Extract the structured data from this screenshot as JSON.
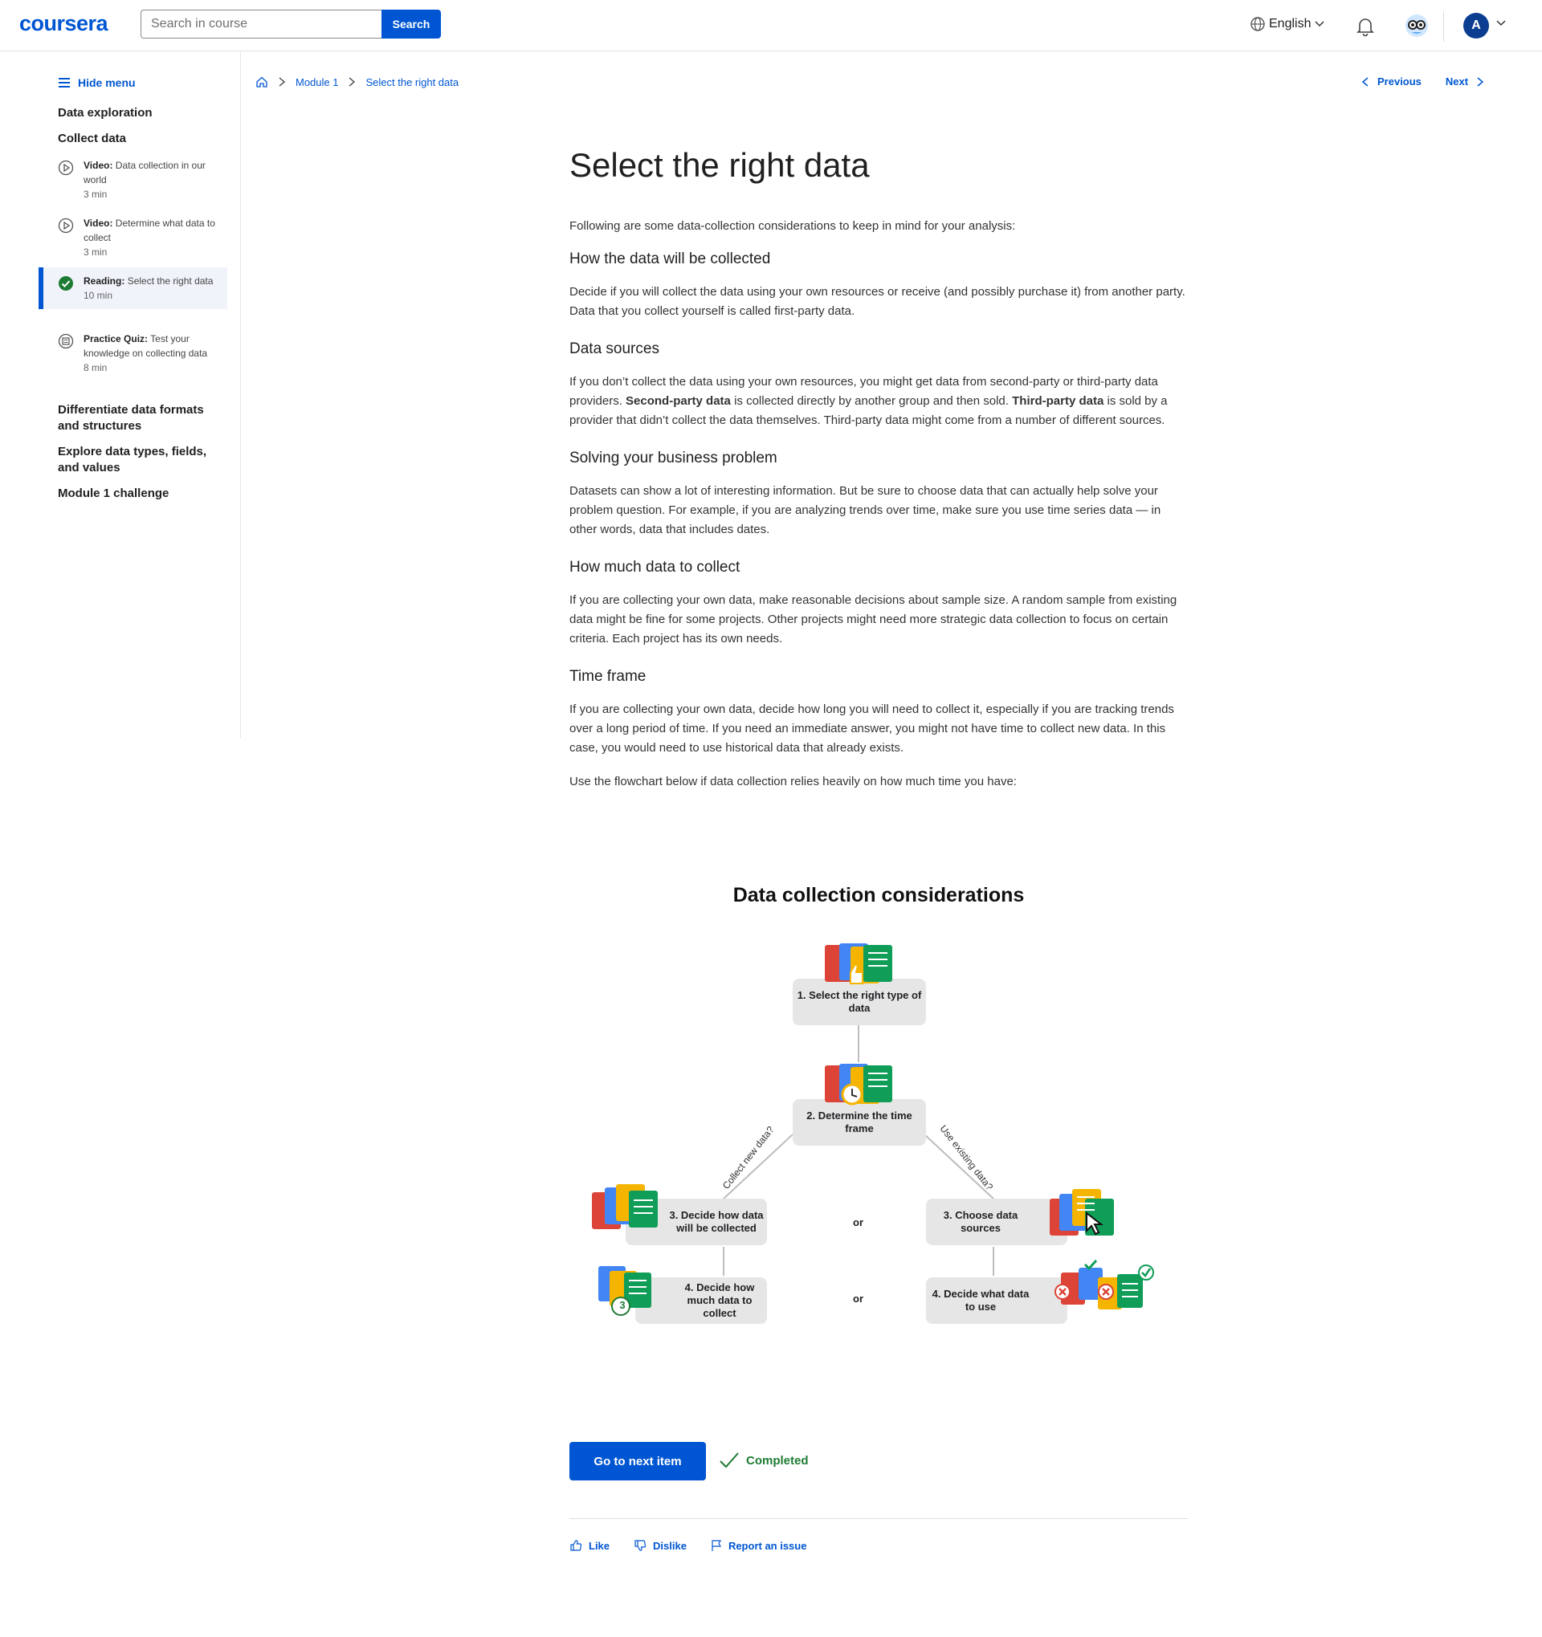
{
  "header": {
    "logo": "coursera",
    "search_placeholder": "Search in course",
    "search_button": "Search",
    "language": "English",
    "avatar_initial": "A"
  },
  "sidebar": {
    "hide_menu": "Hide menu",
    "sections": [
      "Data exploration",
      "Collect data"
    ],
    "items": [
      {
        "type": "Video:",
        "title": "Data collection in our world",
        "duration": "3 min",
        "icon": "play-icon"
      },
      {
        "type": "Video:",
        "title": "Determine what data to collect",
        "duration": "3 min",
        "icon": "play-icon"
      },
      {
        "type": "Reading:",
        "title": "Select the right data",
        "duration": "10 min",
        "icon": "check-circle-icon",
        "active": true
      },
      {
        "type": "Practice Quiz:",
        "title": "Test your knowledge on collecting data",
        "duration": "8 min",
        "icon": "quiz-icon"
      }
    ],
    "more_sections": [
      "Differentiate data formats and structures",
      "Explore data types, fields, and values",
      "Module 1 challenge"
    ]
  },
  "breadcrumb": {
    "module": "Module 1",
    "current": "Select the right data"
  },
  "nav": {
    "previous": "Previous",
    "next": "Next"
  },
  "article": {
    "title": "Select the right data",
    "intro": "Following are some data-collection considerations to keep in mind for your analysis:",
    "sections": [
      {
        "heading": "How the data will be collected",
        "body": "Decide if you will collect the data using your own resources or receive (and possibly purchase it) from another party. Data that you collect yourself is called first-party data."
      },
      {
        "heading": "Data sources",
        "body_parts": [
          "If you don’t collect the data using your own resources, you might get data from second-party or third-party data providers. ",
          "Second-party data",
          " is collected directly by another group and then sold. ",
          "Third-party data",
          " is sold by a provider that didn’t collect the data themselves. Third-party data might come from a number of different sources."
        ]
      },
      {
        "heading": "Solving your business problem",
        "body": "Datasets can show a lot of interesting information. But be sure to choose data that can actually help solve your problem question. For example, if you are analyzing trends over time, make sure you use time series data — in other words, data that includes dates."
      },
      {
        "heading": "How much data to collect",
        "body": "If you are collecting your own data, make reasonable decisions about sample size. A random sample from existing data might be fine for some projects. Other projects might need more strategic data collection to focus on certain criteria. Each project has its own needs."
      },
      {
        "heading": "Time frame",
        "body": "If you are collecting your own data, decide how long you will need to collect it, especially if you are tracking trends over a long period of time. If you need an immediate answer, you might not have time to collect new data. In this case, you would need to use historical data that already exists."
      }
    ],
    "flowchart_intro": "Use the flowchart below if data collection relies heavily on how much time you have:"
  },
  "diagram": {
    "title": "Data collection considerations",
    "step1": "1. Select the right type of data",
    "step2": "2. Determine the time frame",
    "left_branch": "Collect new data?",
    "right_branch": "Use existing data?",
    "left3": "3. Decide how data will be collected",
    "right3": "3. Choose data sources",
    "left4": "4. Decide how much data to collect",
    "right4": "4. Decide what data to use",
    "or": "or",
    "badge_number": "3"
  },
  "footer": {
    "next_button": "Go to next item",
    "completed": "Completed",
    "like": "Like",
    "dislike": "Dislike",
    "report": "Report an issue"
  },
  "colors": {
    "brand": "#0056d2",
    "success": "#1e7b34",
    "doc_red": "#db4437",
    "doc_blue": "#4285f4",
    "doc_yellow": "#f4b400",
    "doc_green": "#0f9d58"
  }
}
